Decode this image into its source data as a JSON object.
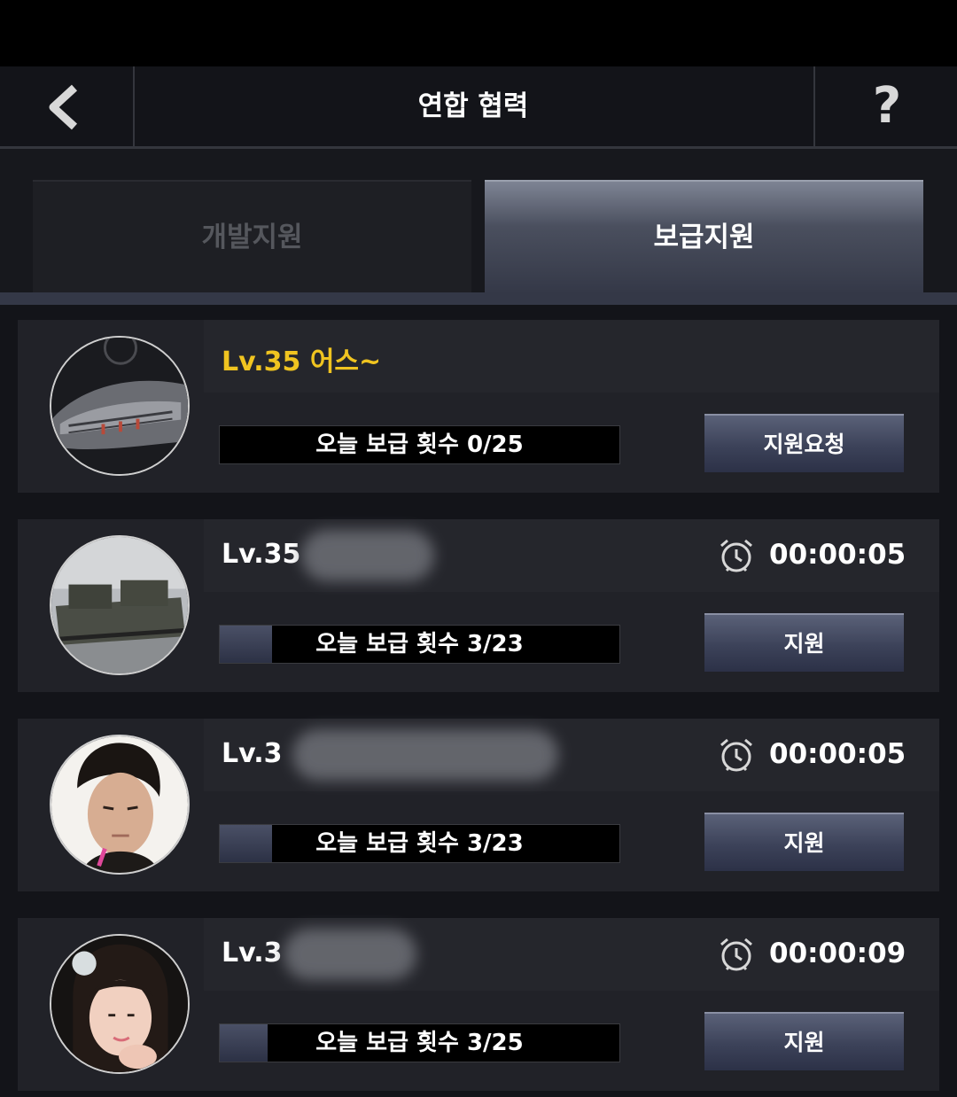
{
  "header": {
    "title": "연합 협력",
    "help_label": "?"
  },
  "tabs": [
    {
      "label": "개발지원",
      "active": false
    },
    {
      "label": "보급지원",
      "active": true
    }
  ],
  "members": [
    {
      "name": "Lv.35 어스~",
      "name_color": "#f0c420",
      "timer": "",
      "supply_label": "오늘 보급 횟수 0/25",
      "supply_progress": 0,
      "button": "지원요청",
      "avatar": "spaceship-icon"
    },
    {
      "name": "Lv.35",
      "timer": "00:00:05",
      "supply_label": "오늘 보급 횟수 3/23",
      "supply_progress": 0.1304,
      "button": "지원",
      "avatar": "military-ship-icon"
    },
    {
      "name": "Lv.3",
      "timer": "00:00:05",
      "supply_label": "오늘 보급 횟수 3/23",
      "supply_progress": 0.1304,
      "button": "지원",
      "avatar": "person-male-icon"
    },
    {
      "name": "Lv.3",
      "timer": "00:00:09",
      "supply_label": "오늘 보급 횟수 3/25",
      "supply_progress": 0.12,
      "button": "지원",
      "avatar": "person-female-icon"
    }
  ]
}
